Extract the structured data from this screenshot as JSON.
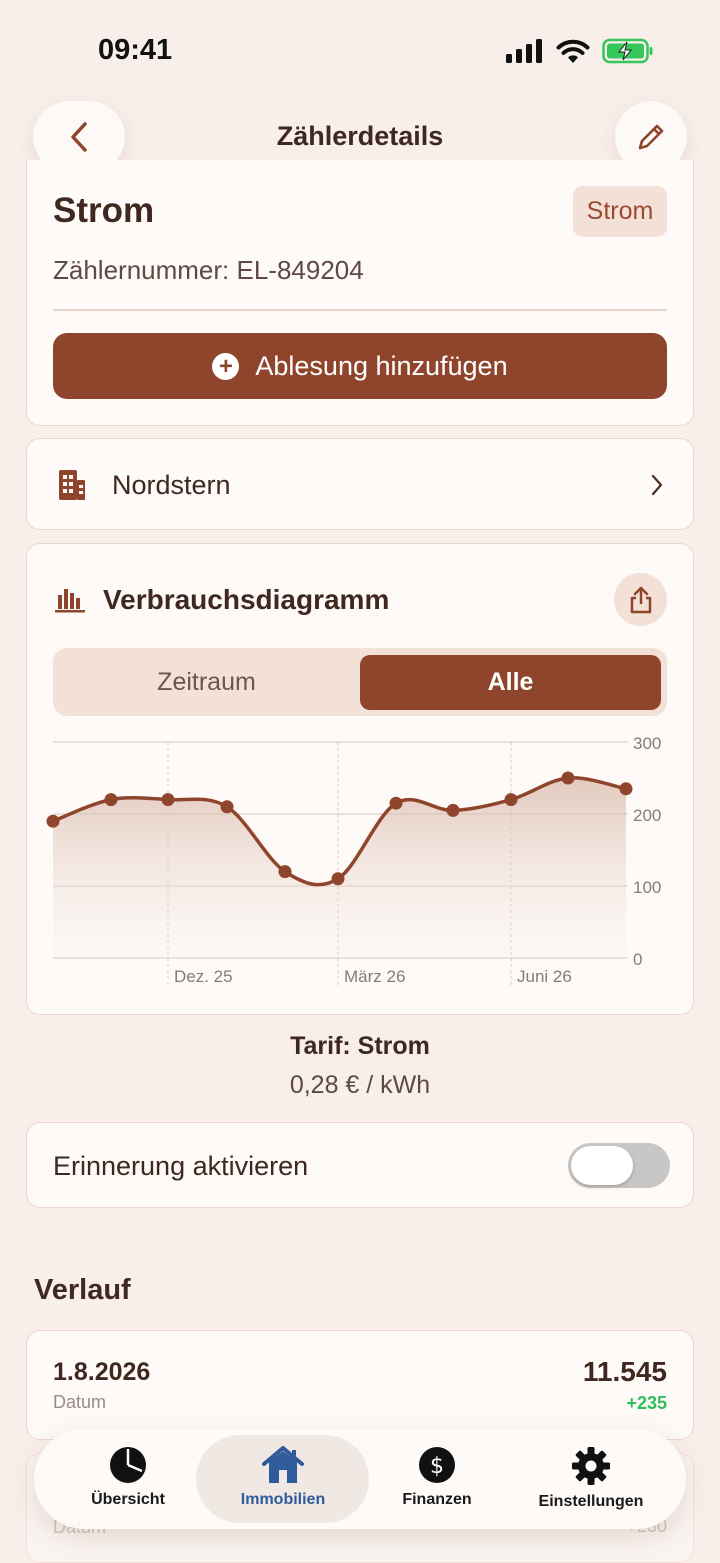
{
  "status_bar": {
    "time": "09:41"
  },
  "header": {
    "title": "Zählerdetails"
  },
  "meter": {
    "type": "Strom",
    "badge": "Strom",
    "number": "Zählernummer: EL-849204",
    "add_reading": "Ablesung hinzufügen"
  },
  "property": {
    "name": "Nordstern"
  },
  "chart_section": {
    "title": "Verbrauchsdiagramm",
    "segments": [
      "Zeitraum",
      "Alle"
    ],
    "selected_segment": "Alle"
  },
  "chart_data": {
    "type": "area",
    "x_tick_labels": [
      "Dez. 25",
      "März 26",
      "Juni 26"
    ],
    "y_ticks": [
      0,
      100,
      200,
      300
    ],
    "ylim": [
      0,
      300
    ],
    "grid": true,
    "y_axis_side": "right",
    "series": [
      {
        "values": [
          190,
          220,
          220,
          210,
          120,
          110,
          215,
          205,
          220,
          250,
          235
        ]
      }
    ],
    "colors": {
      "line": "#8f452b",
      "fill": "#d9b8aa"
    }
  },
  "tariff": {
    "title": "Tarif: Strom",
    "price": "0,28 € / kWh"
  },
  "reminder": {
    "label": "Erinnerung aktivieren",
    "enabled": false
  },
  "history": {
    "title": "Verlauf",
    "entries": [
      {
        "date": "1.8.2026",
        "date_label": "Datum",
        "value": "11.545",
        "delta": "+235"
      },
      {
        "date_label": "Datum",
        "delta": "+230"
      }
    ]
  },
  "tabbar": {
    "items": [
      {
        "label": "Übersicht",
        "icon": "pie-chart-icon"
      },
      {
        "label": "Immobilien",
        "icon": "house-icon"
      },
      {
        "label": "Finanzen",
        "icon": "dollar-icon"
      },
      {
        "label": "Einstellungen",
        "icon": "gear-icon"
      }
    ],
    "active": "Immobilien"
  },
  "colors": {
    "accent": "#8f452b",
    "background": "#f8efea",
    "badge_bg": "#f3e0d7",
    "positive": "#2fbf5a",
    "tab_active": "#2f5b9b"
  }
}
